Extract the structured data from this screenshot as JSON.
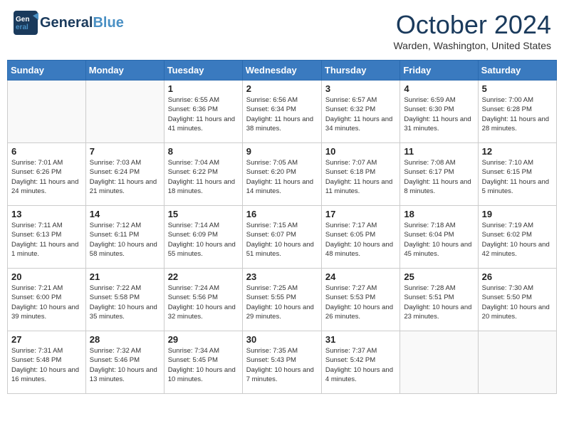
{
  "header": {
    "logo_line1": "General",
    "logo_line2": "Blue",
    "month_title": "October 2024",
    "location": "Warden, Washington, United States"
  },
  "days_of_week": [
    "Sunday",
    "Monday",
    "Tuesday",
    "Wednesday",
    "Thursday",
    "Friday",
    "Saturday"
  ],
  "weeks": [
    [
      {
        "day": "",
        "info": ""
      },
      {
        "day": "",
        "info": ""
      },
      {
        "day": "1",
        "info": "Sunrise: 6:55 AM\nSunset: 6:36 PM\nDaylight: 11 hours and 41 minutes."
      },
      {
        "day": "2",
        "info": "Sunrise: 6:56 AM\nSunset: 6:34 PM\nDaylight: 11 hours and 38 minutes."
      },
      {
        "day": "3",
        "info": "Sunrise: 6:57 AM\nSunset: 6:32 PM\nDaylight: 11 hours and 34 minutes."
      },
      {
        "day": "4",
        "info": "Sunrise: 6:59 AM\nSunset: 6:30 PM\nDaylight: 11 hours and 31 minutes."
      },
      {
        "day": "5",
        "info": "Sunrise: 7:00 AM\nSunset: 6:28 PM\nDaylight: 11 hours and 28 minutes."
      }
    ],
    [
      {
        "day": "6",
        "info": "Sunrise: 7:01 AM\nSunset: 6:26 PM\nDaylight: 11 hours and 24 minutes."
      },
      {
        "day": "7",
        "info": "Sunrise: 7:03 AM\nSunset: 6:24 PM\nDaylight: 11 hours and 21 minutes."
      },
      {
        "day": "8",
        "info": "Sunrise: 7:04 AM\nSunset: 6:22 PM\nDaylight: 11 hours and 18 minutes."
      },
      {
        "day": "9",
        "info": "Sunrise: 7:05 AM\nSunset: 6:20 PM\nDaylight: 11 hours and 14 minutes."
      },
      {
        "day": "10",
        "info": "Sunrise: 7:07 AM\nSunset: 6:18 PM\nDaylight: 11 hours and 11 minutes."
      },
      {
        "day": "11",
        "info": "Sunrise: 7:08 AM\nSunset: 6:17 PM\nDaylight: 11 hours and 8 minutes."
      },
      {
        "day": "12",
        "info": "Sunrise: 7:10 AM\nSunset: 6:15 PM\nDaylight: 11 hours and 5 minutes."
      }
    ],
    [
      {
        "day": "13",
        "info": "Sunrise: 7:11 AM\nSunset: 6:13 PM\nDaylight: 11 hours and 1 minute."
      },
      {
        "day": "14",
        "info": "Sunrise: 7:12 AM\nSunset: 6:11 PM\nDaylight: 10 hours and 58 minutes."
      },
      {
        "day": "15",
        "info": "Sunrise: 7:14 AM\nSunset: 6:09 PM\nDaylight: 10 hours and 55 minutes."
      },
      {
        "day": "16",
        "info": "Sunrise: 7:15 AM\nSunset: 6:07 PM\nDaylight: 10 hours and 51 minutes."
      },
      {
        "day": "17",
        "info": "Sunrise: 7:17 AM\nSunset: 6:05 PM\nDaylight: 10 hours and 48 minutes."
      },
      {
        "day": "18",
        "info": "Sunrise: 7:18 AM\nSunset: 6:04 PM\nDaylight: 10 hours and 45 minutes."
      },
      {
        "day": "19",
        "info": "Sunrise: 7:19 AM\nSunset: 6:02 PM\nDaylight: 10 hours and 42 minutes."
      }
    ],
    [
      {
        "day": "20",
        "info": "Sunrise: 7:21 AM\nSunset: 6:00 PM\nDaylight: 10 hours and 39 minutes."
      },
      {
        "day": "21",
        "info": "Sunrise: 7:22 AM\nSunset: 5:58 PM\nDaylight: 10 hours and 35 minutes."
      },
      {
        "day": "22",
        "info": "Sunrise: 7:24 AM\nSunset: 5:56 PM\nDaylight: 10 hours and 32 minutes."
      },
      {
        "day": "23",
        "info": "Sunrise: 7:25 AM\nSunset: 5:55 PM\nDaylight: 10 hours and 29 minutes."
      },
      {
        "day": "24",
        "info": "Sunrise: 7:27 AM\nSunset: 5:53 PM\nDaylight: 10 hours and 26 minutes."
      },
      {
        "day": "25",
        "info": "Sunrise: 7:28 AM\nSunset: 5:51 PM\nDaylight: 10 hours and 23 minutes."
      },
      {
        "day": "26",
        "info": "Sunrise: 7:30 AM\nSunset: 5:50 PM\nDaylight: 10 hours and 20 minutes."
      }
    ],
    [
      {
        "day": "27",
        "info": "Sunrise: 7:31 AM\nSunset: 5:48 PM\nDaylight: 10 hours and 16 minutes."
      },
      {
        "day": "28",
        "info": "Sunrise: 7:32 AM\nSunset: 5:46 PM\nDaylight: 10 hours and 13 minutes."
      },
      {
        "day": "29",
        "info": "Sunrise: 7:34 AM\nSunset: 5:45 PM\nDaylight: 10 hours and 10 minutes."
      },
      {
        "day": "30",
        "info": "Sunrise: 7:35 AM\nSunset: 5:43 PM\nDaylight: 10 hours and 7 minutes."
      },
      {
        "day": "31",
        "info": "Sunrise: 7:37 AM\nSunset: 5:42 PM\nDaylight: 10 hours and 4 minutes."
      },
      {
        "day": "",
        "info": ""
      },
      {
        "day": "",
        "info": ""
      }
    ]
  ]
}
